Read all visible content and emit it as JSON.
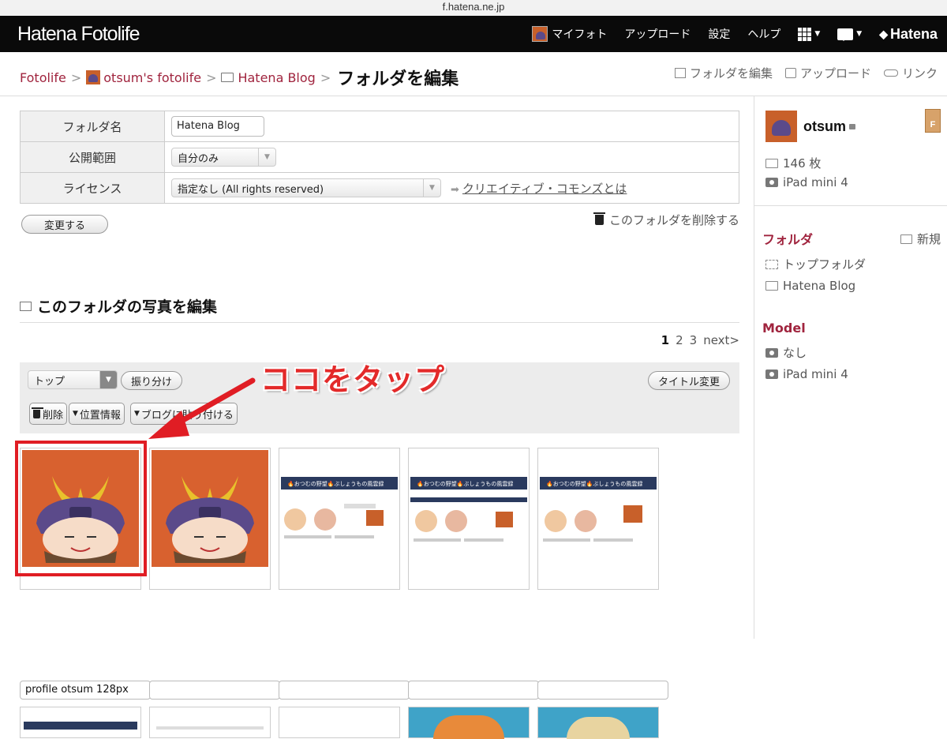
{
  "browser": {
    "url": "f.hatena.ne.jp"
  },
  "topnav": {
    "logo": "Hatena Fotolife",
    "items": [
      "マイフォト",
      "アップロード",
      "設定",
      "ヘルプ"
    ],
    "brand": "Hatena"
  },
  "breadcrumb": {
    "root": "Fotolife",
    "user": "otsum's fotolife",
    "folder": "Hatena Blog",
    "current": "フォルダを編集",
    "sep": ">"
  },
  "header_links": {
    "edit_folder": "フォルダを編集",
    "upload": "アップロード",
    "link": "リンク"
  },
  "form": {
    "folder_name_label": "フォルダ名",
    "folder_name_value": "Hatena Blog",
    "visibility_label": "公開範囲",
    "visibility_value": "自分のみ",
    "license_label": "ライセンス",
    "license_value": "指定なし (All rights reserved)",
    "cc_link": "クリエイティブ・コモンズとは",
    "submit": "変更する",
    "delete_folder": "このフォルダを削除する"
  },
  "photos_section": {
    "title": "このフォルダの写真を編集",
    "pager": {
      "pages": [
        "1",
        "2",
        "3"
      ],
      "current": "1",
      "next": "next>"
    },
    "toolbar": {
      "folder_select": "トップ",
      "distribute": "振り分け",
      "rename_title": "タイトル変更",
      "delete": "削除",
      "location": "位置情報",
      "blog_paste": "ブログに貼り付ける"
    },
    "annotation": "ココをタップ",
    "captions": [
      "profile otsum 128px",
      "",
      "",
      "",
      ""
    ],
    "thumb_header_text": "🔥おつむの野望🔥ぶしょうもの風雲録"
  },
  "sidebar": {
    "username": "otsum",
    "medal": "F",
    "photo_count": "146 枚",
    "device": "iPad mini 4",
    "folder_heading": "フォルダ",
    "new_label": "新規",
    "folders": [
      "トップフォルダ",
      "Hatena Blog"
    ],
    "model_heading": "Model",
    "models": [
      "なし",
      "iPad mini 4"
    ]
  },
  "colors": {
    "accent": "#a0243e",
    "highlight": "#e01d24",
    "nav_bg": "#0a0a0a",
    "thumb_bg": "#d8612f",
    "blog_header": "#2a3a5e"
  }
}
